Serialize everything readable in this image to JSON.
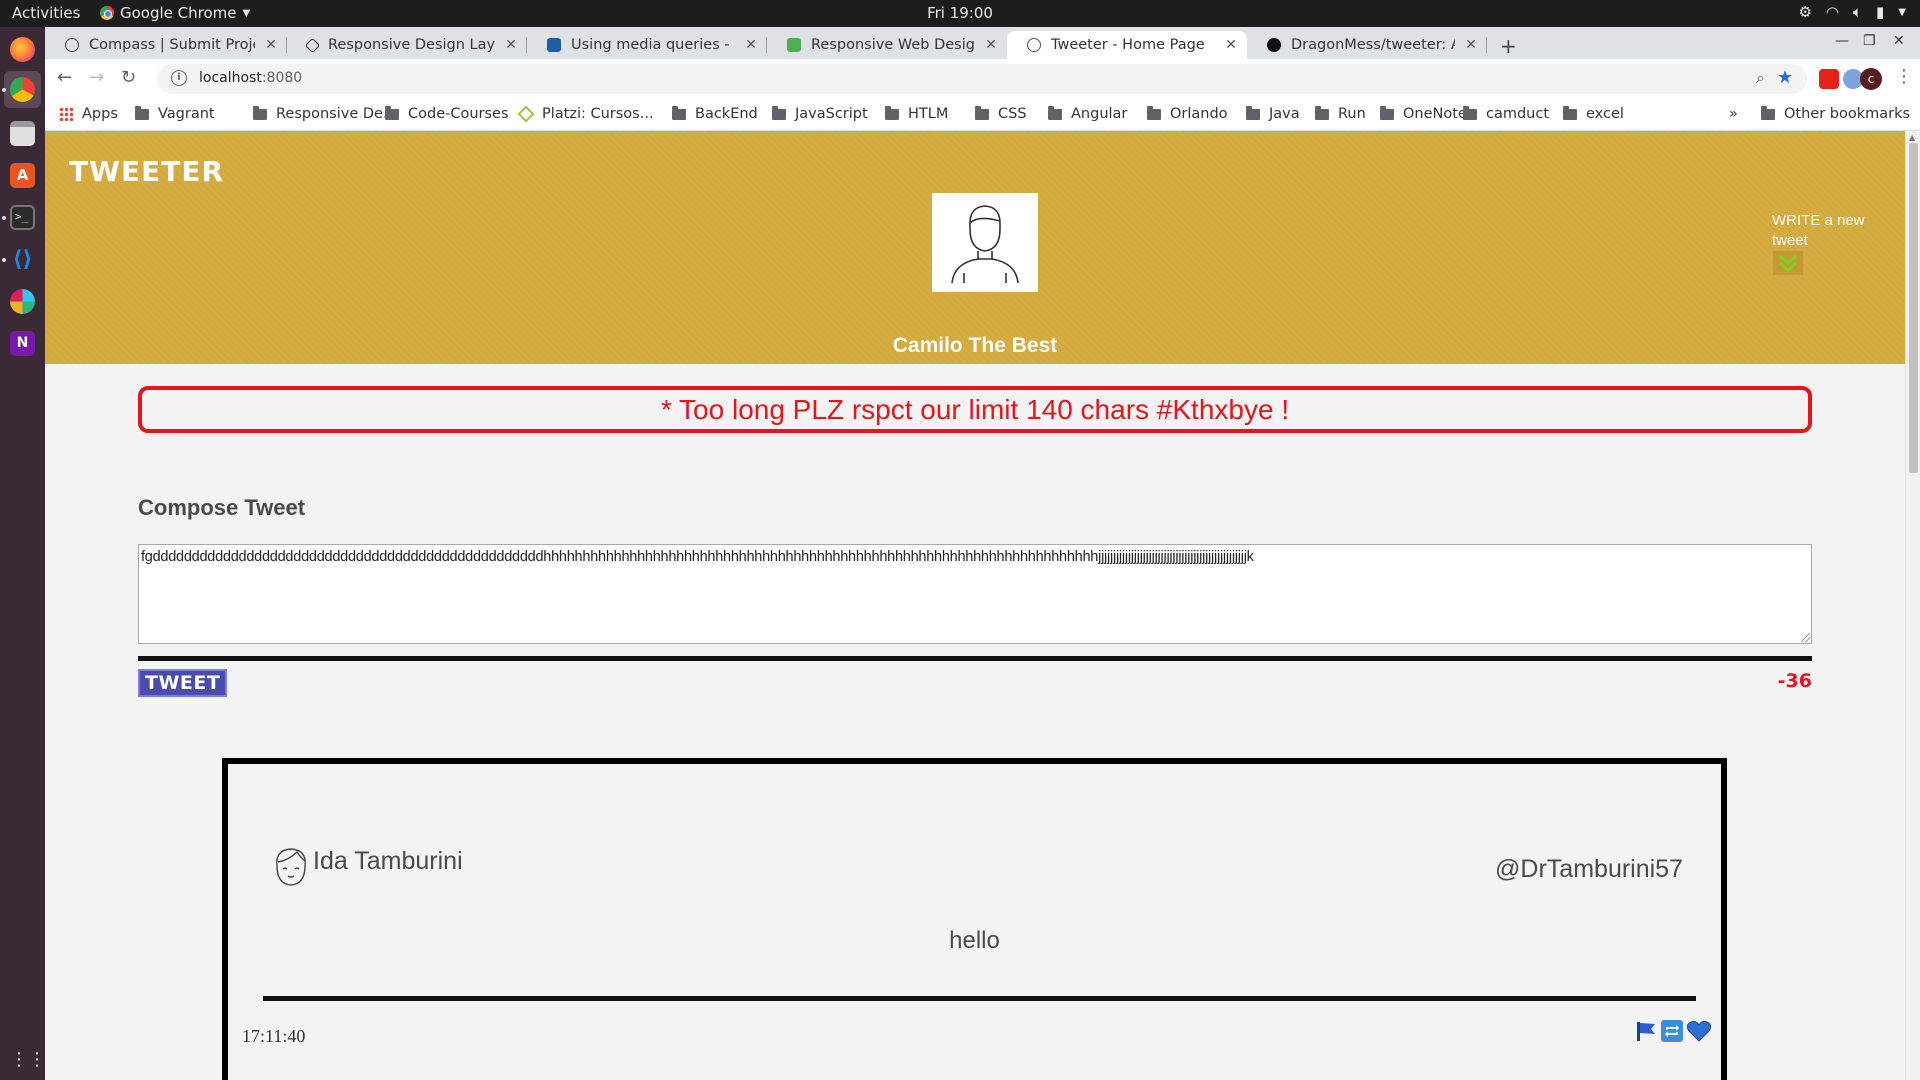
{
  "system": {
    "activities": "Activities",
    "app_name": "Google Chrome",
    "clock": "Fri 19:00"
  },
  "browser": {
    "tabs": [
      {
        "label": "Compass | Submit Project",
        "icon": "compass-icon",
        "active": false
      },
      {
        "label": "Responsive Design Layout",
        "icon": "codepen-icon",
        "active": false
      },
      {
        "label": "Using media queries - CSS",
        "icon": "mdn-icon",
        "active": false
      },
      {
        "label": "Responsive Web Design V",
        "icon": "w3-icon",
        "active": false
      },
      {
        "label": "Tweeter - Home Page",
        "icon": "globe-icon",
        "active": true
      },
      {
        "label": "DragonMess/tweeter: A b",
        "icon": "github-icon",
        "active": false
      }
    ],
    "url_host": "localhost",
    "url_port": ":8080",
    "bookmarks": {
      "apps": "Apps",
      "items": [
        "Vagrant",
        "Responsive De...",
        "Code-Courses",
        "Platzi: Cursos...",
        "BackEnd",
        "JavaScript",
        "HTLM",
        "CSS",
        "Angular",
        "Orlando",
        "Java",
        "Run",
        "OneNote",
        "camduct",
        "excel"
      ],
      "overflow": "»",
      "other": "Other bookmarks"
    },
    "profile_initial": "c"
  },
  "page": {
    "logo": "TWEETER",
    "user_display_name": "Camilo The Best",
    "write_new": "WRITE a new tweet",
    "error_message": "* Too long PLZ rspct our limit 140 chars #Kthxbye !",
    "compose_title": "Compose Tweet",
    "compose_value": "fgddddddddddddddddddddddddddddddddddddddddddddddddddhhhhhhhhhhhhhhhhhhhhhhhhhhhhhhhhhhhhhhhhhhhhhhhhhhhhhhhhhhhhhhhhhhhhhhhjjjjjjjjjjjjjjjjjjjjjjjjjjjjjjjjjjjjjjjjjjjjjjjjjjk",
    "tweet_button": "TWEET",
    "char_counter": "-36",
    "error_color": "#e8141c",
    "header_color": "#d4a93e",
    "button_color": "#4a4cad"
  },
  "tweets": [
    {
      "name": "Ida Tamburini",
      "handle": "@DrTamburini57",
      "content": "hello",
      "time": "17:11:40",
      "actions": [
        "flag-icon",
        "retweet-icon",
        "heart-icon"
      ]
    }
  ]
}
